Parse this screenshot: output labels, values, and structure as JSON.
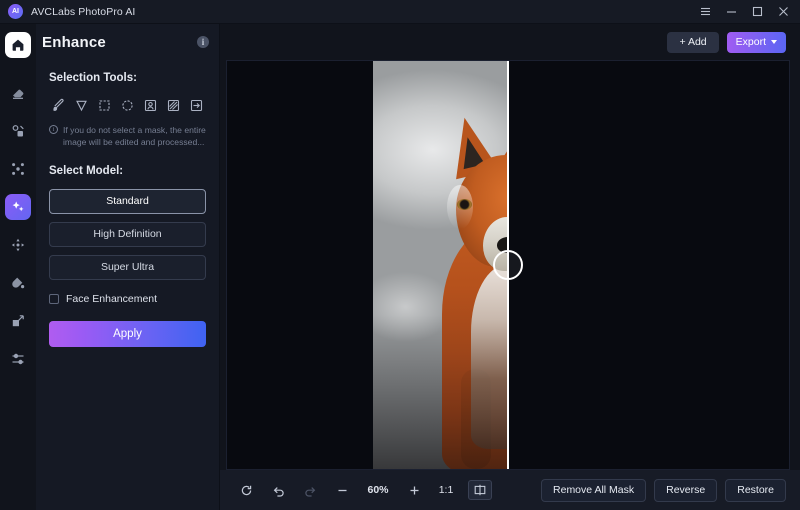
{
  "titlebar": {
    "app_name": "AVCLabs PhotoPro AI",
    "logo_text": "AI",
    "menu_icon": "hamburger-menu-icon",
    "minimize_icon": "minimize-icon",
    "maximize_icon": "maximize-icon",
    "close_icon": "close-icon"
  },
  "rail": {
    "home_icon": "home-icon",
    "items": [
      {
        "icon": "eraser-icon",
        "name": "erase-tool",
        "active": false
      },
      {
        "icon": "object-remove-icon",
        "name": "object-removal-tool",
        "active": false
      },
      {
        "icon": "upscale-icon",
        "name": "upscale-tool",
        "active": false
      },
      {
        "icon": "enhance-sparkle-icon",
        "name": "enhance-tool",
        "active": true
      },
      {
        "icon": "expand-arrows-icon",
        "name": "expand-tool",
        "active": false
      },
      {
        "icon": "color-drop-icon",
        "name": "colorize-tool",
        "active": false
      },
      {
        "icon": "crop-resize-icon",
        "name": "resize-tool",
        "active": false
      },
      {
        "icon": "sliders-icon",
        "name": "adjust-tool",
        "active": false
      }
    ]
  },
  "panel": {
    "title": "Enhance",
    "info_icon": "info-icon",
    "selection_tools_label": "Selection Tools:",
    "tools": [
      {
        "icon": "brush-icon",
        "name": "brush-tool"
      },
      {
        "icon": "lasso-cursor-icon",
        "name": "lasso-tool"
      },
      {
        "icon": "rectangle-select-icon",
        "name": "rectangle-select-tool"
      },
      {
        "icon": "ellipse-select-icon",
        "name": "ellipse-select-tool"
      },
      {
        "icon": "portrait-select-icon",
        "name": "subject-select-tool"
      },
      {
        "icon": "hatched-box-icon",
        "name": "invert-mask-tool"
      },
      {
        "icon": "arrow-into-box-icon",
        "name": "apply-mask-tool"
      }
    ],
    "hint": "If you do not select a mask, the entire image will be edited and processed...",
    "select_model_label": "Select Model:",
    "models": [
      {
        "label": "Standard",
        "selected": true
      },
      {
        "label": "High Definition",
        "selected": false
      },
      {
        "label": "Super Ultra",
        "selected": false
      }
    ],
    "face_enhancement_label": "Face Enhancement",
    "face_enhancement_checked": false,
    "apply_label": "Apply"
  },
  "main": {
    "add_label": "+ Add",
    "export_label": "Export",
    "export_chevron_icon": "chevron-down-icon",
    "canvas": {
      "divider_position_percent": 50,
      "handle_icon": "compare-slider-handle"
    }
  },
  "bottombar": {
    "reset_icon": "reset-rotate-icon",
    "undo_icon": "undo-icon",
    "redo_icon": "redo-icon",
    "zoom_out_icon": "minus-icon",
    "zoom_level": "60%",
    "zoom_in_icon": "plus-icon",
    "actual_size_label": "1:1",
    "compare_icon": "split-compare-icon",
    "remove_all_mask_label": "Remove All Mask",
    "reverse_label": "Reverse",
    "restore_label": "Restore"
  },
  "colors": {
    "accent_purple": "#a05cf2",
    "accent_blue": "#3f63f2",
    "panel_bg": "#151924",
    "window_bg": "#11141c",
    "canvas_bg": "#080a10"
  }
}
